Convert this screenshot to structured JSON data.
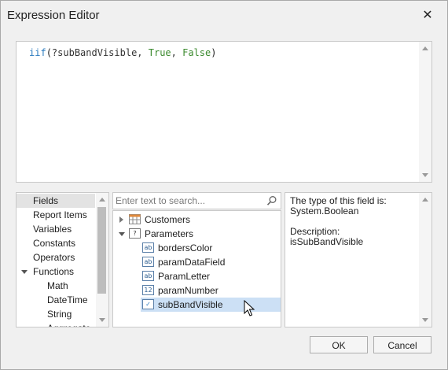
{
  "window": {
    "title": "Expression Editor",
    "close_glyph": "✕"
  },
  "expression": {
    "tokens": [
      {
        "text": "iif",
        "kind": "func"
      },
      {
        "text": "(",
        "kind": "paren"
      },
      {
        "text": "?subBandVisible",
        "kind": "field"
      },
      {
        "text": ", ",
        "kind": "punc"
      },
      {
        "text": "True",
        "kind": "const"
      },
      {
        "text": ", ",
        "kind": "punc"
      },
      {
        "text": "False",
        "kind": "const"
      },
      {
        "text": ")",
        "kind": "paren"
      }
    ]
  },
  "categories": {
    "items": [
      {
        "label": "Fields",
        "selected": true
      },
      {
        "label": "Report Items"
      },
      {
        "label": "Variables"
      },
      {
        "label": "Constants"
      },
      {
        "label": "Operators"
      },
      {
        "label": "Functions",
        "expanded": true
      },
      {
        "label": "Math",
        "child": true
      },
      {
        "label": "DateTime",
        "child": true
      },
      {
        "label": "String",
        "child": true
      },
      {
        "label": "Aggregate",
        "child": true
      }
    ]
  },
  "search": {
    "placeholder": "Enter text to search..."
  },
  "tree": {
    "nodes": [
      {
        "label": "Customers",
        "icon": "table-icon",
        "expander": "collapsed"
      },
      {
        "label": "Parameters",
        "icon": "parameters-icon",
        "icon_text": "?",
        "expander": "expanded"
      },
      {
        "label": "bordersColor",
        "icon": "string-type-icon",
        "icon_text": "ab",
        "child": true
      },
      {
        "label": "paramDataField",
        "icon": "string-type-icon",
        "icon_text": "ab",
        "child": true
      },
      {
        "label": "ParamLetter",
        "icon": "string-type-icon",
        "icon_text": "ab",
        "child": true
      },
      {
        "label": "paramNumber",
        "icon": "number-type-icon",
        "icon_text": "12",
        "child": true
      },
      {
        "label": "subBandVisible",
        "icon": "boolean-type-icon",
        "icon_text": "✓",
        "child": true,
        "selected": true
      }
    ]
  },
  "description": {
    "text": "The type of this field is:\nSystem.Boolean\n\nDescription:\nisSubBandVisible"
  },
  "buttons": {
    "ok": "OK",
    "cancel": "Cancel"
  },
  "colors": {
    "func": "#2b7bbf",
    "const": "#3b8a2e",
    "selection": "#cce0f5",
    "category_selection": "#e3e3e3"
  }
}
